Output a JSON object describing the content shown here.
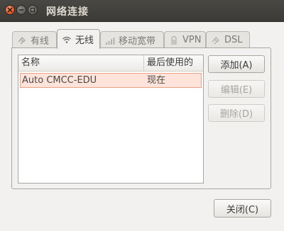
{
  "window": {
    "title": "网络连接"
  },
  "tabs": [
    {
      "label": "有线",
      "icon": "wired-icon",
      "active": false
    },
    {
      "label": "无线",
      "icon": "wifi-icon",
      "active": true
    },
    {
      "label": "移动宽带",
      "icon": "signal-bars-icon",
      "active": false
    },
    {
      "label": "VPN",
      "icon": "lock-icon",
      "active": false
    },
    {
      "label": "DSL",
      "icon": "dsl-icon",
      "active": false
    }
  ],
  "table": {
    "columns": [
      "名称",
      "最后使用的"
    ],
    "rows": [
      {
        "name": "Auto CMCC-EDU",
        "last_used": "现在",
        "selected": true
      }
    ]
  },
  "buttons": {
    "add": "添加(A)",
    "edit": "编辑(E)",
    "delete": "删除(D)",
    "close": "关闭(C)"
  },
  "colors": {
    "titlebar": "#3c3b37",
    "selection": "#fde3da",
    "selection_border": "#f0a388",
    "close_button": "#e0501d"
  }
}
